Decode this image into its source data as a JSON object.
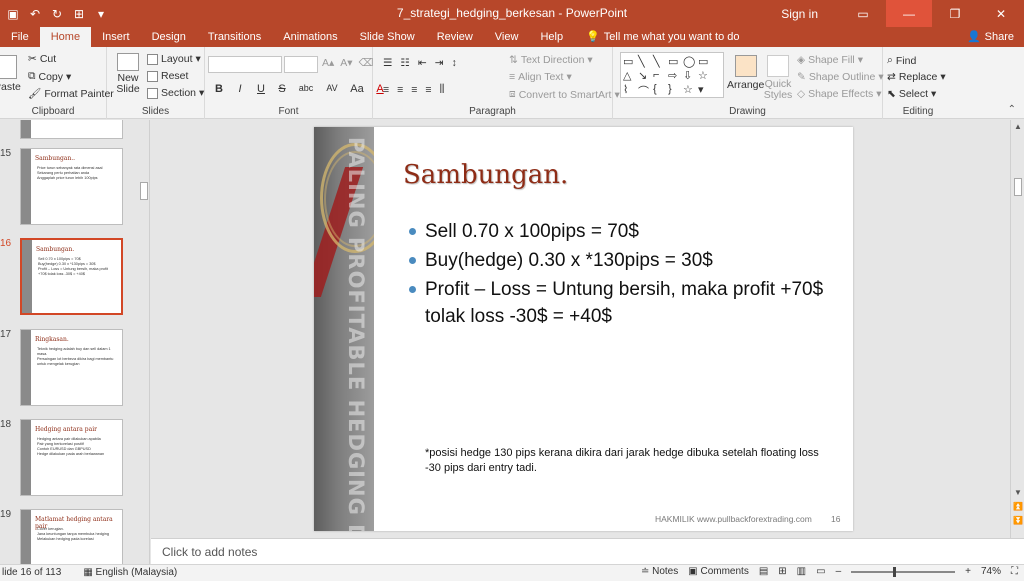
{
  "window": {
    "title": "7_strategi_hedging_berkesan  -  PowerPoint",
    "sign_in": "Sign in",
    "accent": "#b7472a"
  },
  "tabs": [
    {
      "label": "File"
    },
    {
      "label": "Home",
      "active": true
    },
    {
      "label": "Insert"
    },
    {
      "label": "Design"
    },
    {
      "label": "Transitions"
    },
    {
      "label": "Animations"
    },
    {
      "label": "Slide Show"
    },
    {
      "label": "Review"
    },
    {
      "label": "View"
    },
    {
      "label": "Help"
    }
  ],
  "tell_me": "Tell me what you want to do",
  "share": "Share",
  "ribbon": {
    "clipboard": {
      "label": "Clipboard",
      "paste": "Paste",
      "cut": "Cut",
      "copy": "Copy",
      "format_painter": "Format Painter"
    },
    "slides": {
      "label": "Slides",
      "new_slide": "New Slide",
      "layout": "Layout",
      "reset": "Reset",
      "section": "Section"
    },
    "font": {
      "label": "Font",
      "bold": "B",
      "italic": "I",
      "underline": "U",
      "strike": "S",
      "shadow": "abc",
      "spacing": "AV",
      "case": "Aa",
      "color": "A"
    },
    "paragraph": {
      "label": "Paragraph",
      "text_direction": "Text Direction",
      "align_text": "Align Text",
      "convert_smartart": "Convert to SmartArt"
    },
    "drawing": {
      "label": "Drawing",
      "arrange": "Arrange",
      "quick_styles": "Quick Styles",
      "shape_fill": "Shape Fill",
      "shape_outline": "Shape Outline",
      "shape_effects": "Shape Effects"
    },
    "editing": {
      "label": "Editing",
      "find": "Find",
      "replace": "Replace",
      "select": "Select"
    }
  },
  "thumbnails": [
    {
      "num": "15",
      "title": "Sambungan..",
      "lines": [
        "Price turun sebanyak rata dimensi asal",
        "Sekarang perlu perhatian anda",
        "Anggaplah price turun lebih 100pips"
      ]
    },
    {
      "num": "16",
      "title": "Sambungan.",
      "lines": [
        "Sell 0.70 x 100pips = 70$",
        "Buy(hedge) 0.30 x *130pips = 30$",
        "Profit – Loss = Untung bersih, maka profit +70$ tolak loss -30$ = +40$"
      ],
      "current": true
    },
    {
      "num": "17",
      "title": "Ringkasan.",
      "lines": [
        "Teknik hedging adalah buy dan sell dalam 1 masa.",
        "Persaingan lot berbeza dikira bagi membantu untuk mengelak kerugian"
      ]
    },
    {
      "num": "18",
      "title": "Hedging antara pair",
      "lines": [
        "Hedging antara pair dilakukan apabila",
        "Pair yang berkorelasi positif",
        "Contoh EURUSD dan GBPUSD",
        "Hedge dilakukan pada arah berlawanan"
      ]
    },
    {
      "num": "19",
      "title": "Matlamat hedging antara pair",
      "lines": [
        "Cover kerugian.",
        "Jana keuntungan tanpa membuka hedging",
        "Melakukan hedging pada korelasi"
      ]
    }
  ],
  "slide": {
    "title": "Sambungan.",
    "bullets": [
      "Sell 0.70 x 100pips = 70$",
      "Buy(hedge) 0.30 x *130pips = 30$",
      "Profit – Loss = Untung bersih, maka profit +70$ tolak loss -30$ = +40$"
    ],
    "note": "*posisi hedge 130 pips kerana dikira dari jarak hedge dibuka setelah floating loss -30 pips dari entry tadi.",
    "footer": "HAKMILIK www.pullbackforextrading.com",
    "page_number": "16",
    "sidebar_text": "PALING PROFITABLE HEDGING DIBONGKAR! - PALING PROFITABLE HEDGING"
  },
  "notes_placeholder": "Click to add notes",
  "status": {
    "slide_of": "lide 16 of 113",
    "language": "English (Malaysia)",
    "notes": "Notes",
    "comments": "Comments",
    "zoom": "74%"
  }
}
